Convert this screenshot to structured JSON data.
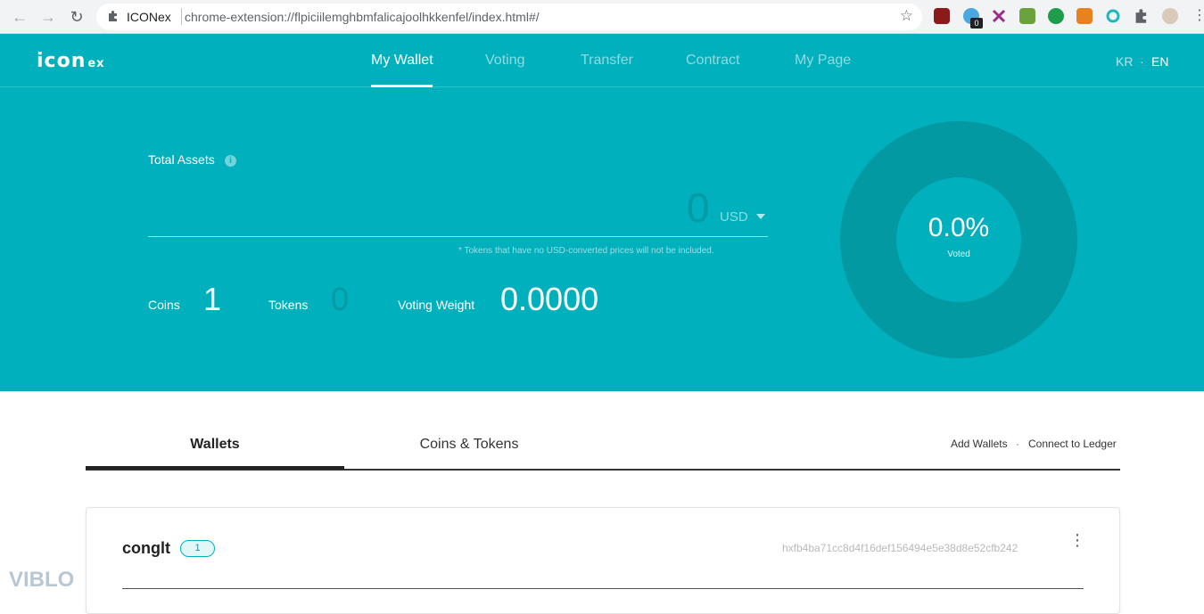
{
  "browser": {
    "site_name": "ICONex",
    "url": "chrome-extension://flpiciilemghbmfalicajoolhkkenfel/index.html#/",
    "extension_badge": "0"
  },
  "app": {
    "logo_text": "icon",
    "logo_suffix": "ex",
    "accent_color": "#00b0bd",
    "nav": [
      {
        "label": "My Wallet",
        "active": true
      },
      {
        "label": "Voting",
        "active": false
      },
      {
        "label": "Transfer",
        "active": false
      },
      {
        "label": "Contract",
        "active": false
      },
      {
        "label": "My Page",
        "active": false
      }
    ],
    "lang": {
      "kr": "KR",
      "separator": "·",
      "en": "EN"
    }
  },
  "assets": {
    "label": "Total Assets",
    "info_icon": "i",
    "value": "0",
    "currency": "USD",
    "note": "* Tokens that have no USD-converted prices will not be included."
  },
  "stats": {
    "coins_label": "Coins",
    "coins_value": "1",
    "tokens_label": "Tokens",
    "tokens_value": "0",
    "voting_weight_label": "Voting Weight",
    "voting_weight_value": "0.0000"
  },
  "donut": {
    "percent": "0.0%",
    "label": "Voted",
    "voted_fraction": 0.0
  },
  "tabs": {
    "wallets": "Wallets",
    "coins_tokens": "Coins & Tokens",
    "add_wallets": "Add Wallets",
    "separator": "·",
    "connect_ledger": "Connect to Ledger"
  },
  "wallet": {
    "name": "conglt",
    "count": "1",
    "address": "hxfb4ba71cc8d4f16def156494e5e38d8e52cfb242",
    "menu_icon": "⋮"
  },
  "watermark": "VIBLO"
}
